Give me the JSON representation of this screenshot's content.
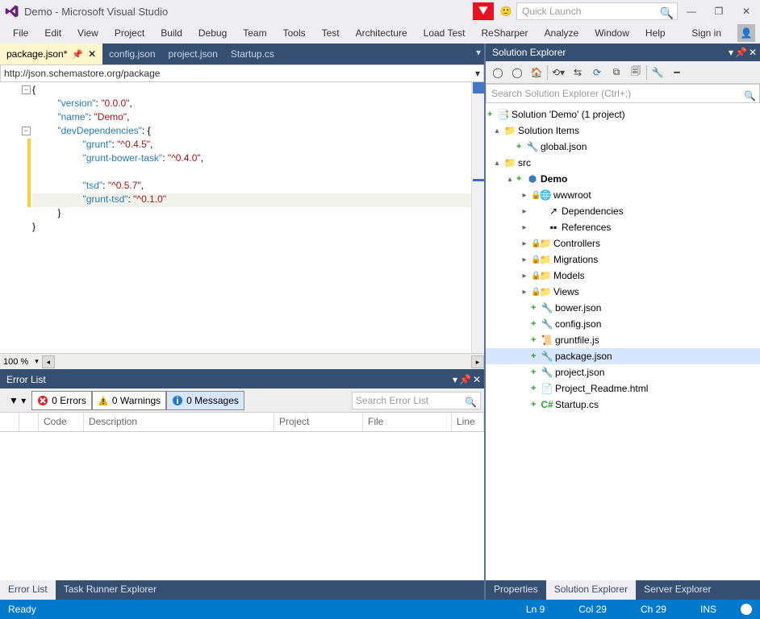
{
  "titlebar": {
    "title": "Demo - Microsoft Visual Studio",
    "quick_placeholder": "Quick Launch"
  },
  "menu": [
    "File",
    "Edit",
    "View",
    "Project",
    "Build",
    "Debug",
    "Team",
    "Tools",
    "Test",
    "Architecture",
    "Load Test",
    "ReSharper",
    "Analyze",
    "Window",
    "Help"
  ],
  "signin": "Sign in",
  "doctabs": {
    "active": "package.json*",
    "others": [
      "config.json",
      "project.json",
      "Startup.cs"
    ]
  },
  "schema": "http://json.schemastore.org/package",
  "code": {
    "version_key": "\"version\"",
    "version_val": "\"0.0.0\"",
    "name_key": "\"name\"",
    "name_val": "\"Demo\"",
    "dev_key": "\"devDependencies\"",
    "grunt_key": "\"grunt\"",
    "grunt_val": "\"^0.4.5\"",
    "gbt_key": "\"grunt-bower-task\"",
    "gbt_val": "\"^0.4.0\"",
    "tsd_key": "\"tsd\"",
    "tsd_val": "\"^0.5.7\"",
    "gtsd_key": "\"grunt-tsd\"",
    "gtsd_val": "\"^0.1.0\""
  },
  "zoom": "100 %",
  "errorlist": {
    "title": "Error List",
    "errors": "0 Errors",
    "warnings": "0 Warnings",
    "messages": "0 Messages",
    "search": "Search Error List",
    "cols": {
      "code": "Code",
      "desc": "Description",
      "project": "Project",
      "file": "File",
      "line": "Line"
    },
    "tabs": [
      "Error List",
      "Task Runner Explorer"
    ]
  },
  "solution": {
    "title": "Solution Explorer",
    "search": "Search Solution Explorer (Ctrl+;)",
    "root": "Solution 'Demo' (1 project)",
    "items": {
      "solution_items": "Solution Items",
      "global": "global.json",
      "src": "src",
      "demo": "Demo",
      "wwwroot": "wwwroot",
      "deps": "Dependencies",
      "refs": "References",
      "controllers": "Controllers",
      "migrations": "Migrations",
      "models": "Models",
      "views": "Views",
      "bower": "bower.json",
      "config": "config.json",
      "grunt": "gruntfile.js",
      "package": "package.json",
      "project": "project.json",
      "readme": "Project_Readme.html",
      "startup": "Startup.cs"
    },
    "tabs": [
      "Properties",
      "Solution Explorer",
      "Server Explorer"
    ]
  },
  "status": {
    "ready": "Ready",
    "ln": "Ln 9",
    "col": "Col 29",
    "ch": "Ch 29",
    "ins": "INS"
  }
}
